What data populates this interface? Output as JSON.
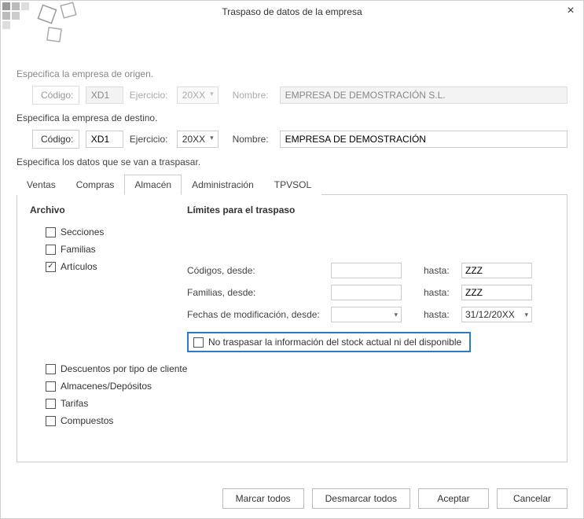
{
  "title": "Traspaso de datos de la empresa",
  "origin": {
    "section": "Especifica la empresa de origen.",
    "codigo_label": "Código:",
    "codigo_value": "XD1",
    "ejercicio_label": "Ejercicio:",
    "ejercicio_value": "20XX",
    "nombre_label": "Nombre:",
    "nombre_value": "EMPRESA DE DEMOSTRACIÓN S.L."
  },
  "dest": {
    "section": "Especifica la empresa de destino.",
    "codigo_label": "Código:",
    "codigo_value": "XD1",
    "ejercicio_label": "Ejercicio:",
    "ejercicio_value": "20XX",
    "nombre_label": "Nombre:",
    "nombre_value": "EMPRESA DE DEMOSTRACIÓN"
  },
  "data_section": "Especifica los datos que se van a traspasar.",
  "tabs": [
    "Ventas",
    "Compras",
    "Almacén",
    "Administración",
    "TPVSOL"
  ],
  "panel": {
    "archivo_header": "Archivo",
    "limites_header": "Límites para el traspaso",
    "chk_secciones": "Secciones",
    "chk_familias": "Familias",
    "chk_articulos": "Artículos",
    "chk_descuentos": "Descuentos por tipo de cliente",
    "chk_almacenes": "Almacenes/Depósitos",
    "chk_tarifas": "Tarifas",
    "chk_compuestos": "Compuestos",
    "lbl_codigos_desde": "Códigos, desde:",
    "lbl_familias_desde": "Familias, desde:",
    "lbl_fechas_desde": "Fechas de modificación, desde:",
    "hasta": "hasta:",
    "codigos_desde_val": "",
    "codigos_hasta_val": "ZZZ",
    "familias_desde_val": "",
    "familias_hasta_val": "ZZZ",
    "fechas_desde_val": "",
    "fechas_hasta_val": "31/12/20XX",
    "chk_no_traspasar": "No traspasar la información del stock actual ni del disponible"
  },
  "buttons": {
    "marcar": "Marcar todos",
    "desmarcar": "Desmarcar todos",
    "aceptar": "Aceptar",
    "cancelar": "Cancelar"
  }
}
